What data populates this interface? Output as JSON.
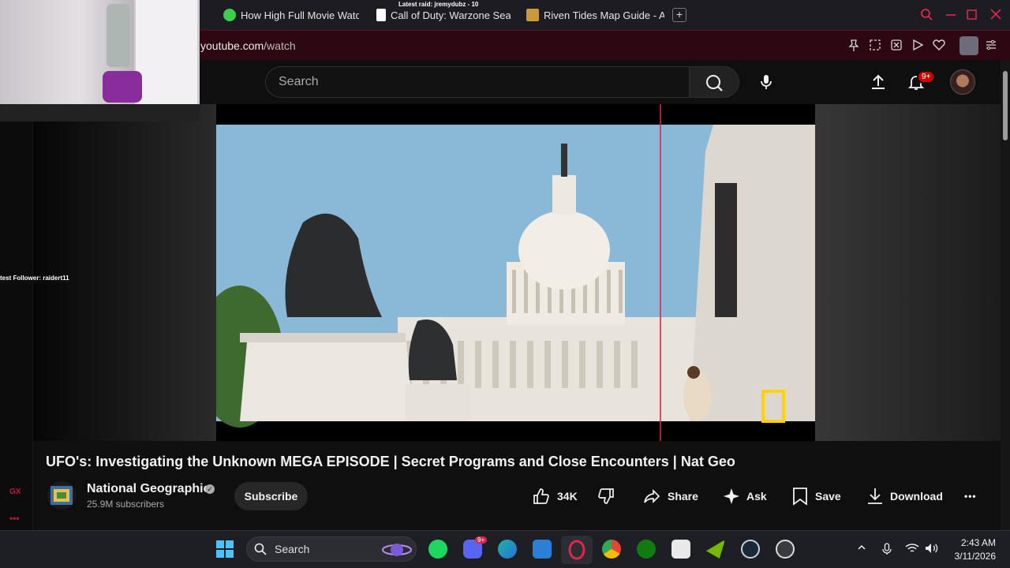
{
  "browser": {
    "tabs": [
      {
        "title": "How High Full Movie Watc",
        "icon_color": "#3ccf4e"
      },
      {
        "title": "Call of Duty: Warzone Sea",
        "icon_color": "#ffffff"
      },
      {
        "title": "Riven Tides Map Guide - A",
        "icon_color": "#c89a3a"
      }
    ],
    "partial_tab_label": "at",
    "new_tab_label": "+",
    "address": {
      "domain": "youtube.com",
      "path": "/watch"
    },
    "accent": "#e0264a"
  },
  "overlay": {
    "raid_text": "Latest raid: jremydubz - 10",
    "follower_text": "test Follower: raidert11"
  },
  "youtube": {
    "search_placeholder": "Search",
    "notification_count": "9+",
    "video_title": "UFO's: Investigating the Unknown MEGA EPISODE | Secret Programs and Close Encounters | Nat Geo",
    "channel_name": "National Geographic",
    "subscribers": "25.9M subscribers",
    "subscribe_label": "Subscribe",
    "like_count": "34K",
    "share_label": "Share",
    "ask_label": "Ask",
    "save_label": "Save",
    "download_label": "Download",
    "more_label": "•••",
    "verified_glyph": "✓"
  },
  "sidebar": {
    "gx_label": "GX",
    "more_label": "•••"
  },
  "taskbar": {
    "search_label": "Search",
    "discord_badge": "9+",
    "time": "2:43 AM",
    "date": "3/11/2026"
  }
}
